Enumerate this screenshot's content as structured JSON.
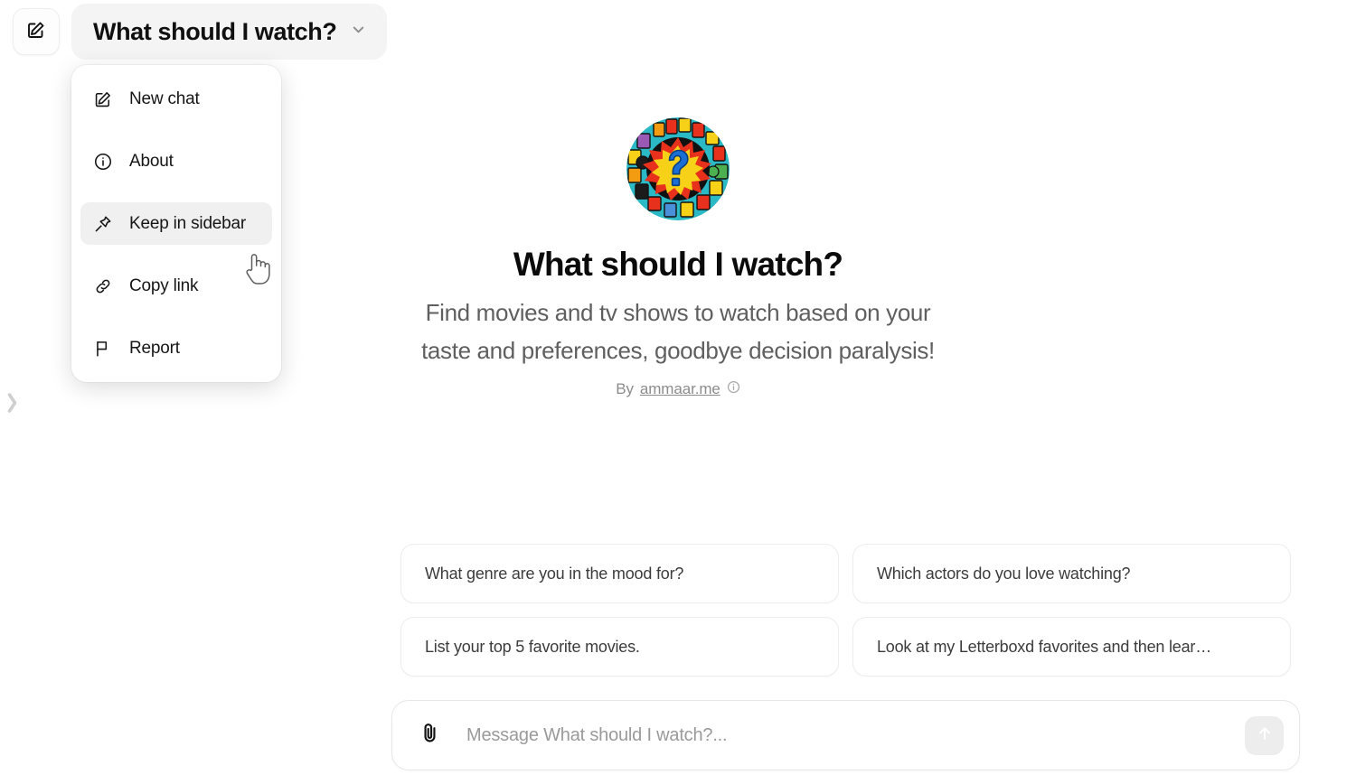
{
  "topbar": {
    "new_chat_button": "new-chat",
    "title": "What should I watch?",
    "chevron": "chevron-down-icon"
  },
  "menu": {
    "items": [
      {
        "label": "New chat",
        "icon": "compose-icon",
        "highlighted": false
      },
      {
        "label": "About",
        "icon": "info-circle-icon",
        "highlighted": false
      },
      {
        "label": "Keep in sidebar",
        "icon": "pin-icon",
        "highlighted": true
      },
      {
        "label": "Copy link",
        "icon": "link-icon",
        "highlighted": false
      },
      {
        "label": "Report",
        "icon": "flag-icon",
        "highlighted": false
      }
    ]
  },
  "sidebar": {
    "expand_handle_icon": "chevron-right-icon"
  },
  "hero": {
    "logo_icon": "question-mark-movie-badge",
    "title": "What should I watch?",
    "description_line1": "Find movies and tv shows to watch based on your",
    "description_line2": "taste and preferences, goodbye decision paralysis!",
    "by_prefix": "By",
    "author": "ammaar.me",
    "info_icon": "info-circle-icon"
  },
  "suggestions": [
    {
      "label": "What genre are you in the mood for?"
    },
    {
      "label": "Which actors do you love watching?"
    },
    {
      "label": "List your top 5 favorite movies."
    },
    {
      "label": "Look at my Letterboxd favorites and then lear…"
    }
  ],
  "composer": {
    "attach_icon": "paperclip-icon",
    "placeholder": "Message What should I watch?...",
    "value": "",
    "send_icon": "arrow-up-icon"
  },
  "colors": {
    "page_background": "#ffffff",
    "pill_background": "#f4f4f4",
    "menu_highlight": "#f0f0f0",
    "chip_border": "#ededed",
    "send_button_background": "#ededed",
    "muted_text": "#5f5f5f",
    "logo_blue": "#1b6fd4",
    "logo_yellow": "#f7d117",
    "logo_red": "#e8311c",
    "logo_teal": "#23b8c4"
  }
}
